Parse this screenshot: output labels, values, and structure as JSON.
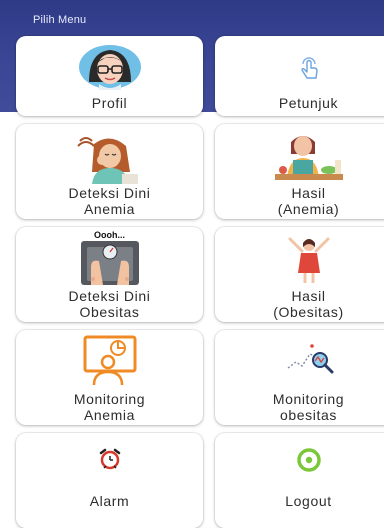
{
  "header": {
    "title": "Pilih Menu"
  },
  "menu": {
    "profil": {
      "label": "Profil"
    },
    "petunjuk": {
      "label": "Petunjuk"
    },
    "deteksi_anemia": {
      "line1": "Deteksi Dini",
      "line2": "Anemia"
    },
    "hasil_anemia": {
      "line1": "Hasil",
      "line2": "(Anemia)"
    },
    "deteksi_obesitas": {
      "line1": "Deteksi Dini",
      "line2": "Obesitas",
      "scale_caption": "Oooh..."
    },
    "hasil_obesitas": {
      "line1": "Hasil",
      "line2": "(Obesitas)"
    },
    "monitoring_anemia": {
      "line1": "Monitoring",
      "line2": "Anemia"
    },
    "monitoring_obesitas": {
      "line1": "Monitoring",
      "line2": "obesitas"
    },
    "alarm": {
      "label": "Alarm"
    },
    "logout": {
      "label": "Logout"
    }
  },
  "icons": {
    "profil": "woman-avatar-icon",
    "petunjuk": "tap-hand-icon",
    "deteksi_anemia": "dizzy-woman-icon",
    "hasil_anemia": "woman-eating-icon",
    "deteksi_obesitas": "weight-scale-icon",
    "hasil_obesitas": "happy-woman-icon",
    "monitoring_anemia": "monitor-user-icon",
    "monitoring_obesitas": "chart-magnifier-icon",
    "alarm": "alarm-clock-icon",
    "logout": "power-ring-icon"
  },
  "colors": {
    "header": "#3b4796",
    "monitor_orange": "#f08a24",
    "logout_green": "#7cc63a",
    "alarm_red": "#d63a2a"
  }
}
